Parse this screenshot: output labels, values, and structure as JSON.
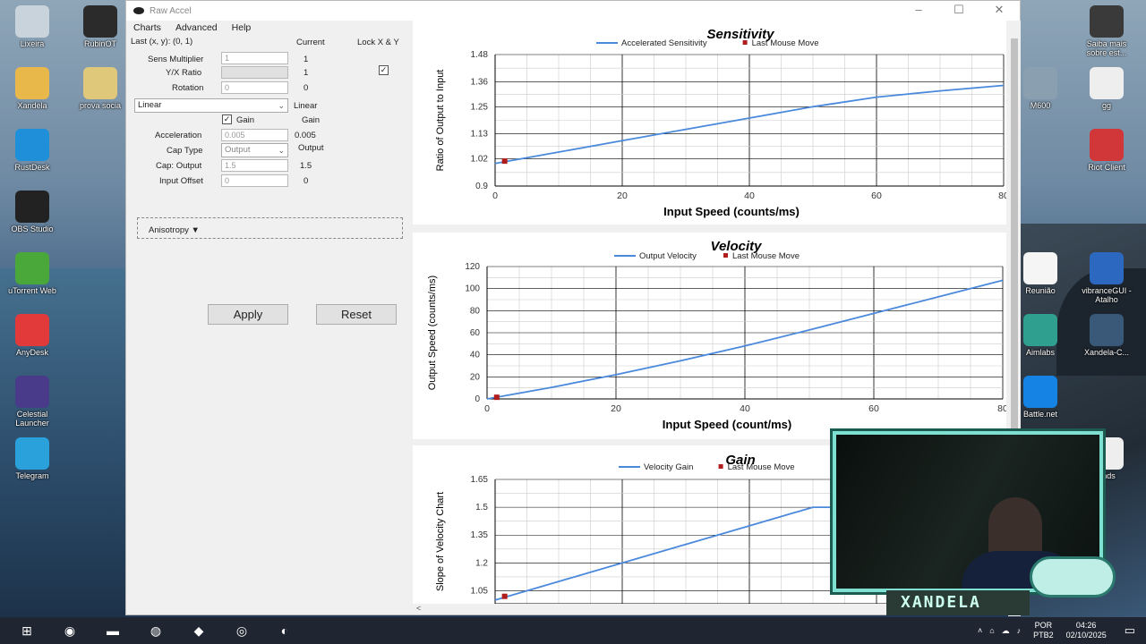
{
  "desktop": {
    "left_icons": [
      {
        "label": "Lixeira",
        "icon": "recycle-bin-icon",
        "color": "#c9d3dc"
      },
      {
        "label": "RubinOT",
        "icon": "rubinot-icon",
        "color": "#2b2b2b"
      },
      {
        "label": "Xandela",
        "icon": "folder-icon",
        "color": "#e8b84a"
      },
      {
        "label": "prova socia",
        "icon": "document-icon",
        "color": "#e0c87a"
      },
      {
        "label": "RustDesk",
        "icon": "rustdesk-icon",
        "color": "#1e8fd8"
      },
      {
        "label": "OBS Studio",
        "icon": "obs-icon",
        "color": "#222"
      },
      {
        "label": "uTorrent Web",
        "icon": "utorrent-icon",
        "color": "#4aa83a"
      },
      {
        "label": "AnyDesk",
        "icon": "anydesk-icon",
        "color": "#e23a3a"
      },
      {
        "label": "Celestial Launcher",
        "icon": "celestial-icon",
        "color": "#4a3a8a"
      },
      {
        "label": "Telegram",
        "icon": "telegram-icon",
        "color": "#2aa1da"
      }
    ],
    "right_icons": [
      {
        "label": "Saiba mais sobre est...",
        "icon": "camera-icon",
        "color": "#3a3a3a"
      },
      {
        "label": "M600",
        "icon": "mouse-icon",
        "color": "#8aa0b0"
      },
      {
        "label": "gg",
        "icon": "text-file-icon",
        "color": "#eeeeee"
      },
      {
        "label": "Riot Client",
        "icon": "riot-icon",
        "color": "#d13639"
      },
      {
        "label": "Reunião",
        "icon": "pdf-icon",
        "color": "#f5f5f5"
      },
      {
        "label": "vibranceGUI - Atalho",
        "icon": "gear-icon",
        "color": "#2c68c0"
      },
      {
        "label": "Aimlabs",
        "icon": "aimlabs-icon",
        "color": "#2fa08f"
      },
      {
        "label": "Xandela-C...",
        "icon": "shortcut-icon",
        "color": "#3a5877"
      },
      {
        "label": "Battle.net",
        "icon": "battlenet-icon",
        "color": "#1583e3"
      },
      {
        "label": "ends",
        "icon": "file-icon",
        "color": "#eeeeee"
      }
    ]
  },
  "window": {
    "title": "Raw Accel",
    "menu": [
      "Charts",
      "Advanced",
      "Help"
    ]
  },
  "settings": {
    "last_xy": "Last (x, y): (0, 1)",
    "current_header": "Current",
    "lock_header": "Lock X & Y",
    "sens_label": "Sens Multiplier",
    "sens_value": "1",
    "sens_current": "1",
    "yx_label": "Y/X Ratio",
    "yx_current": "1",
    "rotation_label": "Rotation",
    "rotation_value": "0",
    "rotation_current": "0",
    "mode": "Linear",
    "mode_current": "Linear",
    "gain_label": "Gain",
    "gain_current": "Gain",
    "accel_label": "Acceleration",
    "accel_value": "0.005",
    "accel_current": "0.005",
    "cap_type_label": "Cap Type",
    "cap_type_value": "Output",
    "cap_type_current": "Output",
    "cap_output_label": "Cap: Output",
    "cap_output_value": "1.5",
    "cap_output_current": "1.5",
    "input_offset_label": "Input Offset",
    "input_offset_value": "0",
    "input_offset_current": "0",
    "anisotropy": "Anisotropy ▼",
    "apply": "Apply",
    "reset": "Reset"
  },
  "colors": {
    "line": "#4a89dc",
    "marker": "#b01d1d",
    "grid": "#000000",
    "minor": "#cccccc"
  },
  "chart_data": [
    {
      "type": "line",
      "title": "Sensitivity",
      "xlabel": "Input Speed (counts/ms)",
      "ylabel": "Ratio of Output to Input",
      "legend": [
        "Accelerated Sensitivity",
        "Last Mouse Move"
      ],
      "xticks": [
        "0",
        "20",
        "40",
        "60",
        "80"
      ],
      "yticks": [
        "0.9",
        "1.02",
        "1.13",
        "1.25",
        "1.36",
        "1.48"
      ],
      "xlim": [
        0,
        80
      ],
      "ylim": [
        0.9,
        1.48
      ],
      "x": [
        0,
        10,
        20,
        30,
        40,
        50,
        60,
        70,
        80
      ],
      "y": [
        1.0,
        1.05,
        1.1,
        1.15,
        1.2,
        1.25,
        1.292,
        1.32,
        1.344
      ],
      "marker": {
        "x": 1.5,
        "y": 1.01
      }
    },
    {
      "type": "line",
      "title": "Velocity",
      "xlabel": "Input Speed (count/ms)",
      "ylabel": "Output Speed (counts/ms)",
      "legend": [
        "Output Velocity",
        "Last Mouse Move"
      ],
      "xticks": [
        "0",
        "20",
        "40",
        "60",
        "80"
      ],
      "yticks": [
        "0",
        "20",
        "40",
        "60",
        "80",
        "100",
        "120"
      ],
      "xlim": [
        0,
        80
      ],
      "ylim": [
        0,
        120
      ],
      "x": [
        0,
        10,
        20,
        30,
        40,
        50,
        60,
        70,
        80
      ],
      "y": [
        0,
        10.5,
        22,
        34.5,
        48,
        62.5,
        77.5,
        92.5,
        107.5
      ],
      "marker": {
        "x": 1.5,
        "y": 1.5
      }
    },
    {
      "type": "line",
      "title": "Gain",
      "xlabel": "",
      "ylabel": "Slope of Velocity Chart",
      "legend": [
        "Velocity Gain",
        "Last Mouse Move"
      ],
      "xticks": [],
      "yticks": [
        "1.05",
        "1.2",
        "1.35",
        "1.5",
        "1.65"
      ],
      "xlim": [
        0,
        80
      ],
      "ylim": [
        0.98,
        1.65
      ],
      "x": [
        0,
        10,
        20,
        30,
        40,
        50,
        60
      ],
      "y": [
        1.0,
        1.1,
        1.2,
        1.3,
        1.4,
        1.5,
        1.5
      ],
      "marker": {
        "x": 1.5,
        "y": 1.02
      }
    }
  ],
  "webcam": {
    "overlay_text": "XANDELA"
  },
  "taskbar": {
    "apps": [
      "windows-start-icon",
      "discord-icon",
      "file-explorer-icon",
      "chrome-icon",
      "rustdesk-red-icon",
      "obs-icon",
      "rawaccel-icon"
    ],
    "lang": "POR",
    "layout": "PTB2",
    "time": "04:26",
    "date": "02/10/2025"
  }
}
